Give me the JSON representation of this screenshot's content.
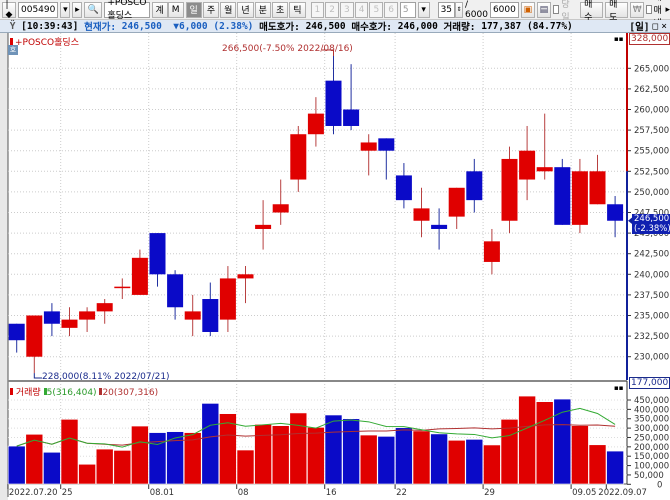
{
  "toolbar": {
    "code": "005490",
    "name": "+POSCO홀딩스",
    "code_btn": "계",
    "m_btn": "M",
    "periods": [
      "일",
      "주",
      "월",
      "년",
      "분",
      "초",
      "틱"
    ],
    "active_period": "일",
    "numbers": [
      "1",
      "2",
      "3",
      "4",
      "5",
      "6"
    ],
    "num_select": "5",
    "count": "35",
    "total_sep": "/ 6000",
    "total_input": "6000",
    "today_label": "당일",
    "buy_label": "매수",
    "sell_label": "매도",
    "won_label": "₩",
    "trade_label": "매매내"
  },
  "info": {
    "time": "[10:39:43]",
    "price_label": "현재가:",
    "price": "246,500",
    "change": "▼6,000",
    "change_pct": "(2.38%)",
    "ask_label": "매도호가:",
    "ask": "246,500",
    "bid_label": "매수호가:",
    "bid": "246,000",
    "volume_label": "거래량:",
    "volume": "177,387",
    "volume_pct": "(84.77%)",
    "mode": "[일]"
  },
  "chart_data": {
    "type": "candlestick",
    "title": "+POSCO홀딩스",
    "colors": {
      "up": "#e00000",
      "down": "#0a0ac8",
      "ma5": "#33aa33",
      "ma20": "#b03030"
    },
    "price_axis": {
      "min": 230000,
      "max": 265000,
      "step": 2500,
      "ticks": [
        "265,000",
        "262,500",
        "260,000",
        "257,500",
        "255,000",
        "252,500",
        "250,000",
        "247,500",
        "245,000",
        "242,500",
        "240,000",
        "237,500",
        "235,000",
        "232,500",
        "230,000"
      ],
      "top_label": "328,000"
    },
    "current": {
      "price": 246500,
      "label": "246,500",
      "pct": "(-2.38%)"
    },
    "high_note": {
      "index": 18,
      "text": "266,500(-7.50% 2022/08/16)"
    },
    "low_note": {
      "index": 1,
      "text": "228,000(8.11% 2022/07/21)"
    },
    "ohlc": [
      [
        234000,
        234000,
        230500,
        232000
      ],
      [
        230000,
        235000,
        228000,
        235000
      ],
      [
        235500,
        236500,
        232500,
        234000
      ],
      [
        233500,
        236000,
        232500,
        234500
      ],
      [
        234500,
        236000,
        233000,
        235500
      ],
      [
        235500,
        237000,
        234000,
        236500
      ],
      [
        238500,
        239500,
        237000,
        238500
      ],
      [
        237500,
        243000,
        237500,
        242000
      ],
      [
        245000,
        245000,
        238500,
        240000
      ],
      [
        240000,
        240500,
        234500,
        236000
      ],
      [
        234500,
        237500,
        232500,
        235500
      ],
      [
        237000,
        239000,
        232500,
        233000
      ],
      [
        234500,
        241000,
        233000,
        239500
      ],
      [
        239500,
        241000,
        236500,
        240000
      ],
      [
        245500,
        249000,
        243000,
        246000
      ],
      [
        247500,
        251500,
        246000,
        248500
      ],
      [
        251500,
        258000,
        250000,
        257000
      ],
      [
        257000,
        261500,
        255500,
        259500
      ],
      [
        263500,
        266500,
        257000,
        258000
      ],
      [
        260000,
        265500,
        257500,
        258000
      ],
      [
        255000,
        257000,
        252000,
        256000
      ],
      [
        256500,
        256500,
        251500,
        255000
      ],
      [
        252000,
        253500,
        248000,
        249000
      ],
      [
        246500,
        250500,
        244500,
        248000
      ],
      [
        246000,
        248000,
        243000,
        245500
      ],
      [
        247000,
        250500,
        245500,
        250500
      ],
      [
        252500,
        254000,
        247500,
        249000
      ],
      [
        241500,
        245500,
        240000,
        244000
      ],
      [
        246500,
        255500,
        245000,
        254000
      ],
      [
        251500,
        258000,
        249000,
        255000
      ],
      [
        252500,
        259500,
        251500,
        253000
      ],
      [
        253000,
        254000,
        246000,
        246000
      ],
      [
        246000,
        254000,
        245000,
        252500
      ],
      [
        248500,
        254500,
        248500,
        252500
      ],
      [
        248500,
        249500,
        244500,
        246500
      ]
    ],
    "volume": [
      204000,
      267000,
      171000,
      347000,
      107000,
      188000,
      181000,
      311000,
      276000,
      281000,
      276000,
      432000,
      377000,
      183000,
      320000,
      313000,
      381000,
      304000,
      370000,
      350000,
      263000,
      256000,
      302000,
      285000,
      269000,
      235000,
      240000,
      210000,
      347000,
      471000,
      441000,
      455000,
      313000,
      211000,
      177387
    ],
    "volume_axis": {
      "max_label": "177,000",
      "ticks": [
        "450,000",
        "400,000",
        "350,000",
        "300,000",
        "250,000",
        "200,000",
        "150,000",
        "100,000",
        "50,000",
        "0"
      ]
    },
    "volume_legend": {
      "name": "거래량",
      "ma5": "5(316,404)",
      "ma20": "20(307,316)"
    },
    "x_labels": [
      {
        "index": 0,
        "text": "2022.07.20"
      },
      {
        "index": 3,
        "text": "25"
      },
      {
        "index": 8,
        "text": "08.01"
      },
      {
        "index": 13,
        "text": "08"
      },
      {
        "index": 18,
        "text": "16"
      },
      {
        "index": 22,
        "text": "22"
      },
      {
        "index": 27,
        "text": "29"
      },
      {
        "index": 32,
        "text": "09.05"
      },
      {
        "index": 34,
        "text": "2022.09.07"
      }
    ]
  }
}
